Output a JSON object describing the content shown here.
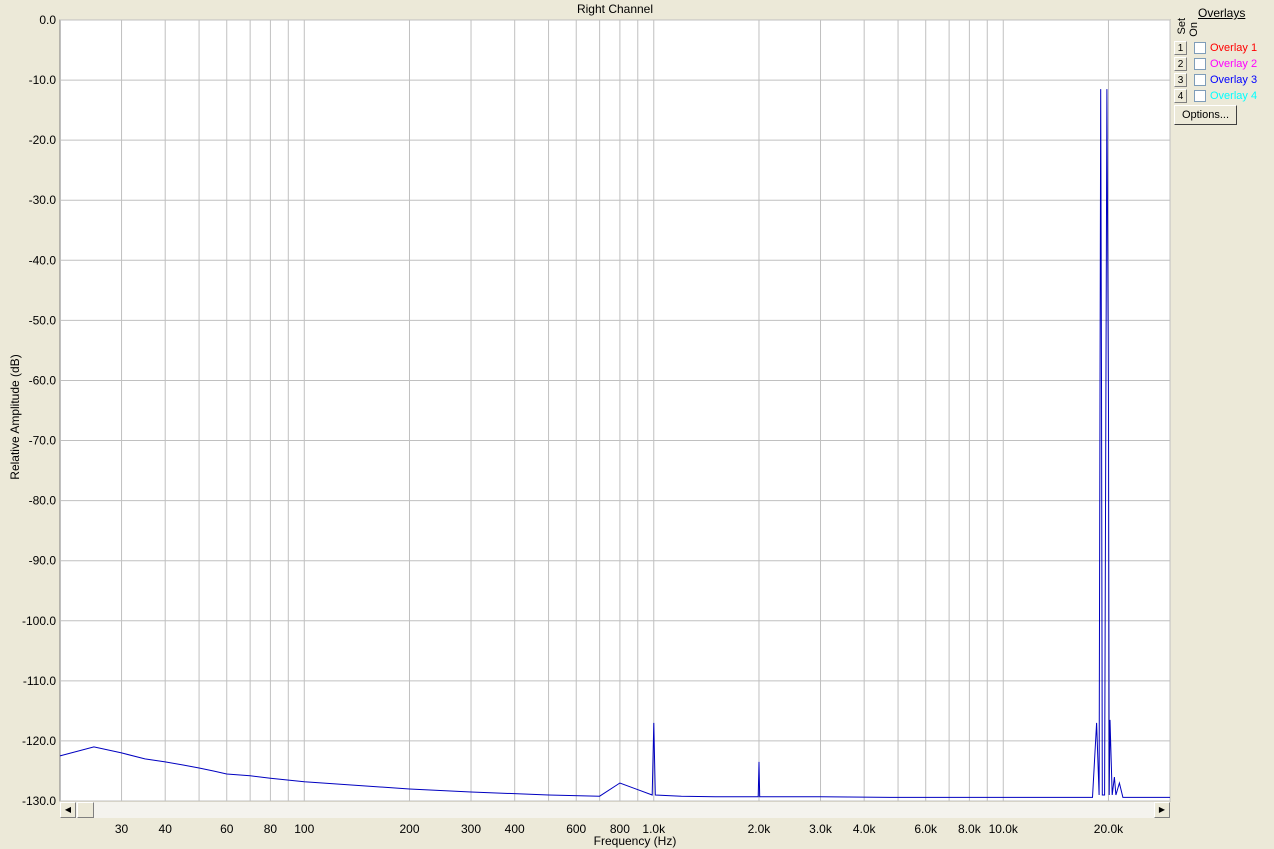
{
  "chart_data": {
    "type": "line",
    "title": "Right Channel",
    "xlabel": "Frequency (Hz)",
    "ylabel": "Relative Amplitude (dB)",
    "x_scale": "log",
    "xlim": [
      20,
      30000
    ],
    "ylim": [
      -130,
      0
    ],
    "grid": true,
    "yticks": [
      0,
      -10,
      -20,
      -30,
      -40,
      -50,
      -60,
      -70,
      -80,
      -90,
      -100,
      -110,
      -120,
      -130
    ],
    "ytick_labels": [
      "0.0",
      "-10.0",
      "-20.0",
      "-30.0",
      "-40.0",
      "-50.0",
      "-60.0",
      "-70.0",
      "-80.0",
      "-90.0",
      "-100.0",
      "-110.0",
      "-120.0",
      "-130.0"
    ],
    "xticks": [
      30,
      40,
      60,
      80,
      100,
      200,
      300,
      400,
      600,
      800,
      1000,
      2000,
      3000,
      4000,
      6000,
      8000,
      10000,
      20000
    ],
    "xtick_labels": [
      "30",
      "40",
      "60",
      "80",
      "100",
      "200",
      "300",
      "400",
      "600",
      "800",
      "1.0k",
      "2.0k",
      "3.0k",
      "4.0k",
      "6.0k",
      "8.0k",
      "10.0k",
      "20.0k"
    ],
    "series": [
      {
        "color": "#0000C0",
        "x": [
          20,
          25,
          30,
          35,
          40,
          45,
          50,
          55,
          60,
          70,
          80,
          100,
          150,
          200,
          300,
          500,
          700,
          800,
          990,
          1000,
          1010,
          1200,
          1500,
          1990,
          2000,
          2010,
          3000,
          5000,
          7000,
          10000,
          15000,
          18000,
          18500,
          18800,
          19000,
          19100,
          19200,
          19500,
          19800,
          20000,
          20100,
          20200,
          20500,
          20800,
          21000,
          21500,
          22000,
          25000,
          30000
        ],
        "y": [
          -122.5,
          -121,
          -122,
          -123,
          -123.5,
          -124,
          -124.5,
          -125,
          -125.5,
          -125.8,
          -126.2,
          -126.8,
          -127.5,
          -128,
          -128.5,
          -129,
          -129.2,
          -127,
          -129,
          -117,
          -129,
          -129.2,
          -129.3,
          -129.3,
          -123.5,
          -129.3,
          -129.3,
          -129.4,
          -129.4,
          -129.4,
          -129.4,
          -129.4,
          -117,
          -129,
          -11.5,
          -60,
          -129,
          -129,
          -11.5,
          -65,
          -129,
          -116.5,
          -129,
          -126,
          -129,
          -127,
          -129.4,
          -129.4,
          -129.4
        ]
      }
    ]
  },
  "overlays_panel": {
    "title": "Overlays",
    "set_label": "Set",
    "on_label": "On",
    "items": [
      {
        "number": "1",
        "label": "Overlay 1",
        "color": "#FF0000"
      },
      {
        "number": "2",
        "label": "Overlay 2",
        "color": "#FF00FF"
      },
      {
        "number": "3",
        "label": "Overlay 3",
        "color": "#0000FF"
      },
      {
        "number": "4",
        "label": "Overlay 4",
        "color": "#00FFFF"
      }
    ],
    "options_label": "Options..."
  },
  "scrollbar": {
    "left_arrow": "◀",
    "right_arrow": "▶"
  }
}
